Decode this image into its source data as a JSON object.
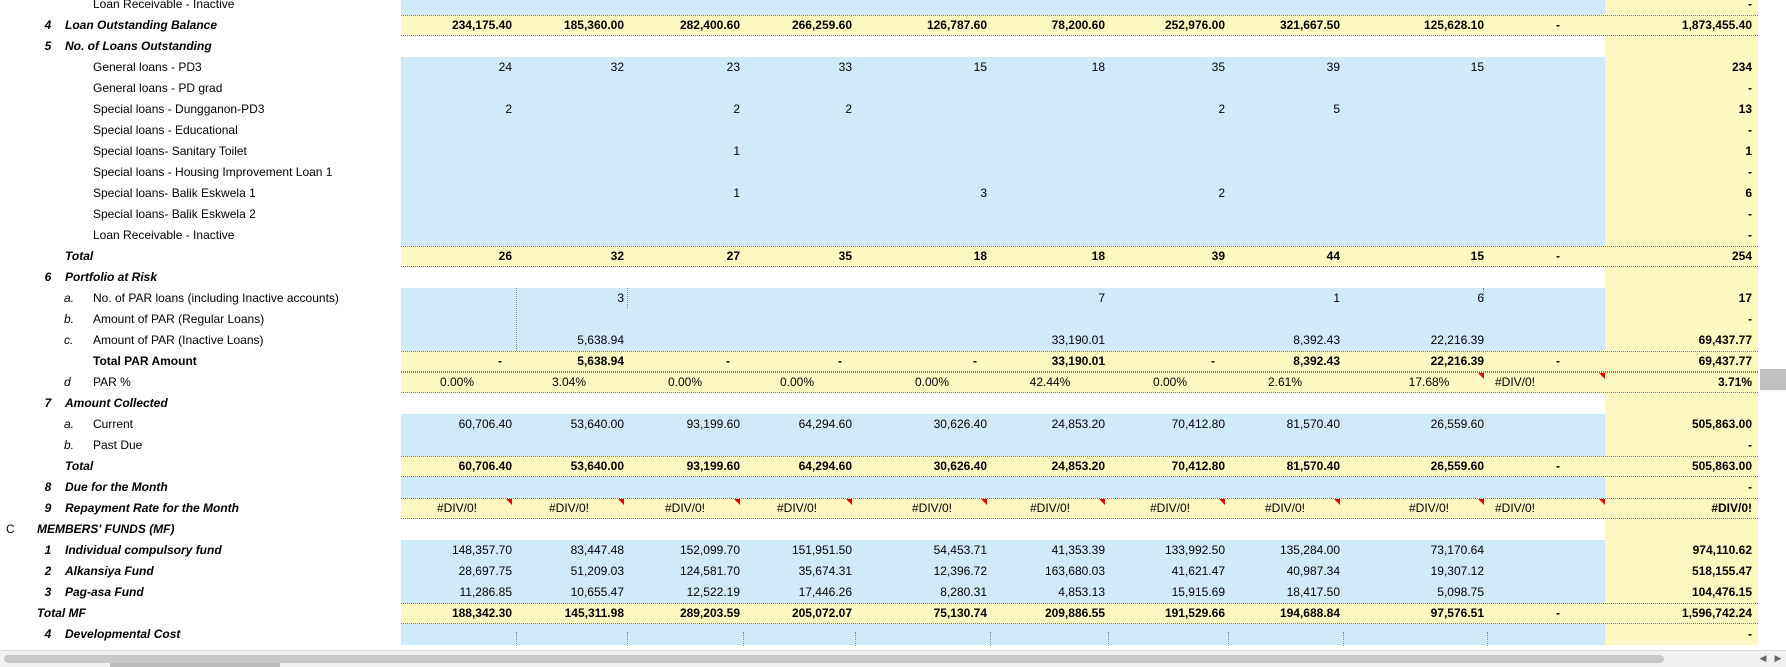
{
  "sheet": {
    "rows": [
      {
        "id": "r0",
        "label_type": "sub",
        "label": "Loan Receivable - Inactive",
        "band": "blue",
        "values": [
          "",
          "",
          "",
          "",
          "",
          "",
          "",
          "",
          "",
          ""
        ],
        "total": "-",
        "bold": false
      },
      {
        "id": "r1",
        "num": "4",
        "label_type": "main",
        "label": "Loan Outstanding Balance",
        "band": "yellow",
        "values": [
          "234,175.40",
          "185,360.00",
          "282,400.60",
          "266,259.60",
          "126,787.60",
          "78,200.60",
          "252,976.00",
          "321,667.50",
          "125,628.10",
          "-"
        ],
        "total": "1,873,455.40",
        "bold": true
      },
      {
        "id": "r2",
        "num": "5",
        "label_type": "main",
        "label": "No. of Loans Outstanding",
        "band": "none",
        "values": [
          "",
          "",
          "",
          "",
          "",
          "",
          "",
          "",
          "",
          ""
        ],
        "total": "",
        "bold": false
      },
      {
        "id": "r3",
        "label_type": "sub",
        "label": "General loans - PD3",
        "band": "blue",
        "values": [
          "24",
          "32",
          "23",
          "33",
          "15",
          "18",
          "35",
          "39",
          "15",
          ""
        ],
        "total": "234",
        "bold": false
      },
      {
        "id": "r4",
        "label_type": "sub",
        "label": "General loans - PD grad",
        "band": "blue",
        "values": [
          "",
          "",
          "",
          "",
          "",
          "",
          "",
          "",
          "",
          ""
        ],
        "total": "-",
        "bold": false
      },
      {
        "id": "r5",
        "label_type": "sub",
        "label": "Special loans - Dungganon-PD3",
        "band": "blue",
        "values": [
          "2",
          "",
          "2",
          "2",
          "",
          "",
          "2",
          "5",
          "",
          ""
        ],
        "total": "13",
        "bold": false
      },
      {
        "id": "r6",
        "label_type": "sub",
        "label": "Special loans - Educational",
        "band": "blue",
        "values": [
          "",
          "",
          "",
          "",
          "",
          "",
          "",
          "",
          "",
          ""
        ],
        "total": "-",
        "bold": false
      },
      {
        "id": "r7",
        "label_type": "sub",
        "label": "Special loans- Sanitary Toilet",
        "band": "blue",
        "values": [
          "",
          "",
          "1",
          "",
          "",
          "",
          "",
          "",
          "",
          ""
        ],
        "total": "1",
        "bold": false
      },
      {
        "id": "r8",
        "label_type": "sub",
        "label": "Special loans - Housing Improvement Loan 1",
        "band": "blue",
        "values": [
          "",
          "",
          "",
          "",
          "",
          "",
          "",
          "",
          "",
          ""
        ],
        "total": "-",
        "bold": false
      },
      {
        "id": "r9",
        "label_type": "sub",
        "label": "Special loans- Balik Eskwela 1",
        "band": "blue",
        "values": [
          "",
          "",
          "1",
          "",
          "3",
          "",
          "2",
          "",
          "",
          ""
        ],
        "total": "6",
        "bold": false
      },
      {
        "id": "r10",
        "label_type": "sub",
        "label": "Special loans- Balik Eskwela 2",
        "band": "blue",
        "values": [
          "",
          "",
          "",
          "",
          "",
          "",
          "",
          "",
          "",
          ""
        ],
        "total": "-",
        "bold": false
      },
      {
        "id": "r11",
        "label_type": "sub",
        "label": "Loan Receivable - Inactive",
        "band": "blue",
        "values": [
          "",
          "",
          "",
          "",
          "",
          "",
          "",
          "",
          "",
          ""
        ],
        "total": "-",
        "bold": false
      },
      {
        "id": "r12",
        "label_type": "total-italic",
        "label": "Total",
        "band": "yellow",
        "values": [
          "26",
          "32",
          "27",
          "35",
          "18",
          "18",
          "39",
          "44",
          "15",
          "-"
        ],
        "total": "254",
        "bold": true
      },
      {
        "id": "r13",
        "num": "6",
        "label_type": "main",
        "label": "Portfolio at Risk",
        "band": "none",
        "values": [
          "",
          "",
          "",
          "",
          "",
          "",
          "",
          "",
          "",
          ""
        ],
        "total": "",
        "bold": false
      },
      {
        "id": "r14",
        "letter": "a.",
        "label_type": "sub",
        "label": "No. of PAR loans (including Inactive accounts)",
        "band": "blue",
        "values": [
          "",
          "3",
          "",
          "",
          "",
          "7",
          "",
          "1",
          "6",
          ""
        ],
        "total": "17",
        "bold": false
      },
      {
        "id": "r15",
        "letter": "b.",
        "label_type": "sub",
        "label": "Amount of PAR (Regular Loans)",
        "band": "blue",
        "values": [
          "",
          "",
          "",
          "",
          "",
          "",
          "",
          "",
          "",
          ""
        ],
        "total": "-",
        "bold": false
      },
      {
        "id": "r16",
        "letter": "c.",
        "label_type": "sub",
        "label": "Amount of PAR (Inactive Loans)",
        "band": "blue",
        "values": [
          "",
          "5,638.94",
          "",
          "",
          "",
          "33,190.01",
          "",
          "8,392.43",
          "22,216.39",
          ""
        ],
        "total": "69,437.77",
        "bold": false
      },
      {
        "id": "r17",
        "label_type": "sub-bold",
        "label": "Total PAR Amount",
        "band": "yellow",
        "values": [
          "-",
          "5,638.94",
          "-",
          "-",
          "-",
          "33,190.01",
          "-",
          "8,392.43",
          "22,216.39",
          "-"
        ],
        "total": "69,437.77",
        "bold": true
      },
      {
        "id": "r18",
        "letter": "d",
        "label_type": "sub",
        "label": "PAR %",
        "band": "yellow",
        "values": [
          "0.00%",
          "3.04%",
          "0.00%",
          "0.00%",
          "0.00%",
          "42.44%",
          "0.00%",
          "2.61%",
          "17.68%",
          "#DIV/0!"
        ],
        "total": "3.71%",
        "bold": false
      },
      {
        "id": "r19",
        "num": "7",
        "label_type": "main",
        "label": "Amount Collected",
        "band": "none",
        "values": [
          "",
          "",
          "",
          "",
          "",
          "",
          "",
          "",
          "",
          ""
        ],
        "total": "",
        "bold": false
      },
      {
        "id": "r20",
        "letter": "a.",
        "label_type": "sub",
        "label": "Current",
        "band": "blue",
        "values": [
          "60,706.40",
          "53,640.00",
          "93,199.60",
          "64,294.60",
          "30,626.40",
          "24,853.20",
          "70,412.80",
          "81,570.40",
          "26,559.60",
          ""
        ],
        "total": "505,863.00",
        "bold": false
      },
      {
        "id": "r21",
        "letter": "b.",
        "label_type": "sub",
        "label": "Past Due",
        "band": "blue",
        "values": [
          "",
          "",
          "",
          "",
          "",
          "",
          "",
          "",
          "",
          ""
        ],
        "total": "-",
        "bold": false
      },
      {
        "id": "r22",
        "label_type": "total-italic",
        "label": "Total",
        "band": "yellow",
        "values": [
          "60,706.40",
          "53,640.00",
          "93,199.60",
          "64,294.60",
          "30,626.40",
          "24,853.20",
          "70,412.80",
          "81,570.40",
          "26,559.60",
          "-"
        ],
        "total": "505,863.00",
        "bold": true
      },
      {
        "id": "r23",
        "num": "8",
        "label_type": "main",
        "label": "Due for the Month",
        "band": "blue",
        "values": [
          "",
          "",
          "",
          "",
          "",
          "",
          "",
          "",
          "",
          ""
        ],
        "total": "-",
        "bold": false
      },
      {
        "id": "r24",
        "num": "9",
        "label_type": "main",
        "label": "Repayment Rate for the Month",
        "band": "yellow",
        "values": [
          "#DIV/0!",
          "#DIV/0!",
          "#DIV/0!",
          "#DIV/0!",
          "#DIV/0!",
          "#DIV/0!",
          "#DIV/0!",
          "#DIV/0!",
          "#DIV/0!",
          "#DIV/0!"
        ],
        "total": "#DIV/0!",
        "bold": false
      },
      {
        "id": "r25",
        "c": "C",
        "label_type": "section",
        "label": "MEMBERS' FUNDS (MF)",
        "band": "none",
        "values": [
          "",
          "",
          "",
          "",
          "",
          "",
          "",
          "",
          "",
          ""
        ],
        "total": "",
        "bold": false
      },
      {
        "id": "r26",
        "num": "1",
        "label_type": "main",
        "label": "Individual compulsory fund",
        "band": "blue",
        "values": [
          "148,357.70",
          "83,447.48",
          "152,099.70",
          "151,951.50",
          "54,453.71",
          "41,353.39",
          "133,992.50",
          "135,284.00",
          "73,170.64",
          ""
        ],
        "total": "974,110.62",
        "bold": false
      },
      {
        "id": "r27",
        "num": "2",
        "label_type": "main",
        "label": "Alkansiya Fund",
        "band": "blue",
        "values": [
          "28,697.75",
          "51,209.03",
          "124,581.70",
          "35,674.31",
          "12,396.72",
          "163,680.03",
          "41,621.47",
          "40,987.34",
          "19,307.12",
          ""
        ],
        "total": "518,155.47",
        "bold": false
      },
      {
        "id": "r28",
        "num": "3",
        "label_type": "main",
        "label": "Pag-asa Fund",
        "band": "blue",
        "values": [
          "11,286.85",
          "10,655.47",
          "12,522.19",
          "17,446.26",
          "8,280.31",
          "4,853.13",
          "15,915.69",
          "18,417.50",
          "5,098.75",
          ""
        ],
        "total": "104,476.15",
        "bold": false
      },
      {
        "id": "r29",
        "label_type": "total-mf",
        "label": "Total MF",
        "band": "yellow",
        "values": [
          "188,342.30",
          "145,311.98",
          "289,203.59",
          "205,072.07",
          "75,130.74",
          "209,886.55",
          "191,529.66",
          "194,688.84",
          "97,576.51",
          "-"
        ],
        "total": "1,596,742.24",
        "bold": true
      },
      {
        "id": "r30",
        "num": "4",
        "label_type": "main",
        "label": "Developmental Cost",
        "band": "blue",
        "values": [
          "",
          "",
          "",
          "",
          "",
          "",
          "",
          "",
          "",
          ""
        ],
        "total": "-",
        "bold": false
      }
    ]
  },
  "colors": {
    "blue_band": "#cfeaf9",
    "yellow_band": "#fdf8c1",
    "error_marker": "#e00000"
  },
  "scrollbar": {
    "left_arrow": "◀",
    "right_arrow": "▶"
  }
}
